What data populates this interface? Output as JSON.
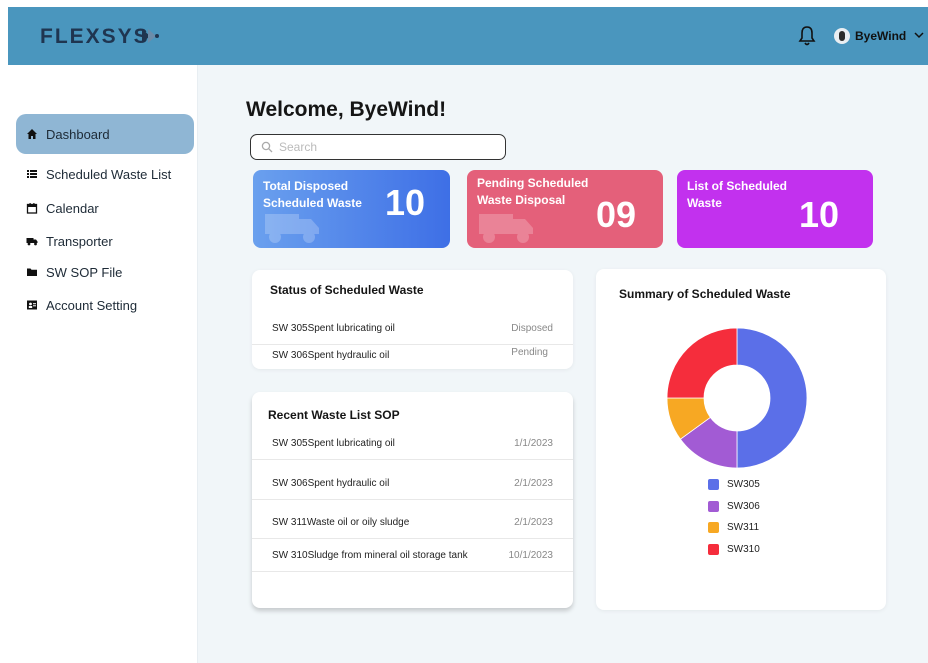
{
  "header": {
    "logo_text": "FLEXSYS",
    "user_name": "ByeWind",
    "icons": {
      "notifications": "bell-icon",
      "user": "avatar",
      "menu": "chevron-down-icon"
    }
  },
  "sidebar": {
    "items": [
      {
        "label": "Dashboard",
        "icon": "home-icon",
        "active": true
      },
      {
        "label": "Scheduled Waste List",
        "icon": "list-icon"
      },
      {
        "label": "Calendar",
        "icon": "calendar-icon"
      },
      {
        "label": "Transporter",
        "icon": "truck-icon"
      },
      {
        "label": "SW SOP File",
        "icon": "folder-icon"
      },
      {
        "label": "Account Setting",
        "icon": "account-icon"
      }
    ]
  },
  "main": {
    "welcome": "Welcome,  ByeWind!",
    "search_placeholder": "Search",
    "cards": [
      {
        "label": "Total Disposed Scheduled Waste",
        "value": "10",
        "color": "#4a7ee9"
      },
      {
        "label": "Pending Scheduled Waste Disposal",
        "value": "09",
        "color": "#e4607a"
      },
      {
        "label": "List of Scheduled Waste",
        "value": "10",
        "color": "#c231ee"
      }
    ],
    "status": {
      "title": "Status of Scheduled Waste",
      "rows": [
        {
          "name": "SW 305Spent lubricating oil",
          "status": "Disposed"
        },
        {
          "name": "SW 306Spent hydraulic oil",
          "status": "Pending"
        }
      ]
    },
    "recent": {
      "title": "Recent Waste List SOP",
      "rows": [
        {
          "name": "SW 305Spent lubricating oil",
          "date": "1/1/2023"
        },
        {
          "name": "SW 306Spent hydraulic oil",
          "date": "2/1/2023"
        },
        {
          "name": "SW 311Waste oil or oily sludge",
          "date": "2/1/2023"
        },
        {
          "name": "SW 310Sludge from mineral oil storage tank",
          "date": "10/1/2023"
        }
      ]
    },
    "summary": {
      "title": "Summary of Scheduled Waste"
    }
  },
  "chart_data": {
    "type": "pie",
    "donut": true,
    "title": "Summary of Scheduled Waste",
    "legend_position": "bottom",
    "series": [
      {
        "name": "SW305",
        "value": 50,
        "color": "#5b6fe8"
      },
      {
        "name": "SW306",
        "value": 15,
        "color": "#a25bd4"
      },
      {
        "name": "SW311",
        "value": 10,
        "color": "#f7a823"
      },
      {
        "name": "SW310",
        "value": 25,
        "color": "#f52d3c"
      }
    ]
  }
}
